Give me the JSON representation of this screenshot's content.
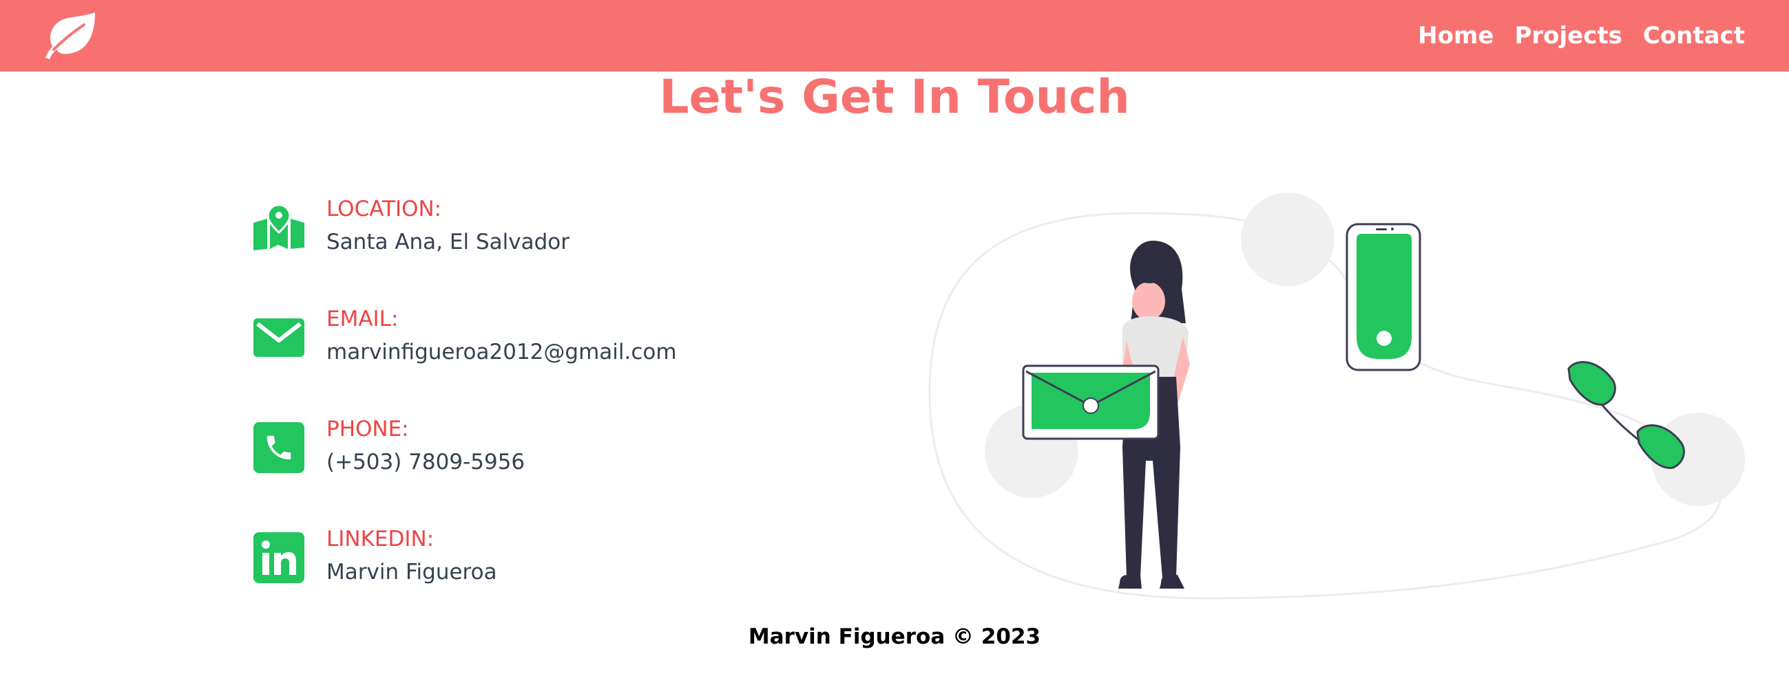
{
  "nav": {
    "logo_icon": "leaf-icon",
    "links": [
      "Home",
      "Projects",
      "Contact"
    ]
  },
  "page": {
    "title": "Let's Get In Touch"
  },
  "contacts": [
    {
      "label": "LOCATION:",
      "value": "Santa Ana, El Salvador",
      "icon": "map-pin-icon"
    },
    {
      "label": "EMAIL:",
      "value": "marvinfigueroa2012@gmail.com",
      "icon": "envelope-icon"
    },
    {
      "label": "PHONE:",
      "value": "(+503) 7809-5956",
      "icon": "phone-icon"
    },
    {
      "label": "LINKEDIN:",
      "value": "Marvin Figueroa",
      "icon": "linkedin-icon"
    }
  ],
  "footer": {
    "text": "Marvin Figueroa © 2023"
  },
  "colors": {
    "nav_background": "#f87171",
    "title": "#f87171",
    "label": "#ef4444",
    "value": "#374151",
    "accent_green": "#22c55e"
  }
}
